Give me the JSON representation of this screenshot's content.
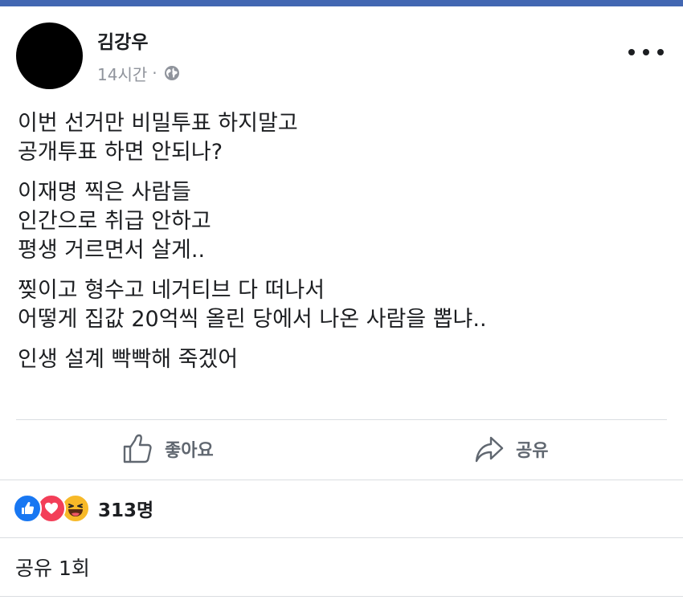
{
  "post": {
    "author": "김강우",
    "time": "14시간",
    "separator": "·",
    "privacy_icon": "globe-icon",
    "more_icon": "more-horizontal-icon",
    "paragraphs": [
      "이번 선거만 비밀투표 하지말고\n공개투표 하면 안되나?",
      "이재명 찍은 사람들\n인간으로 취급 안하고\n평생 거르면서 살게..",
      "찢이고 형수고 네거티브 다 떠나서\n어떻게 집값 20억씩 올린 당에서 나온 사람을 뽑냐..",
      "인생 설계 빡빡해 죽겠어"
    ]
  },
  "actions": {
    "like_label": "좋아요",
    "like_icon": "thumbs-up-icon",
    "share_label": "공유",
    "share_icon": "share-arrow-icon"
  },
  "reactions": {
    "icons": [
      "like-reaction-icon",
      "love-reaction-icon",
      "haha-reaction-icon"
    ],
    "count": "313명"
  },
  "shares": {
    "count_label": "공유 1회"
  },
  "colors": {
    "top_bar": "#4267b2",
    "like": "#1877f2",
    "love": "#f33e58",
    "haha": "#f7b928",
    "muted_text": "#90949c",
    "divider": "#dadde1"
  }
}
